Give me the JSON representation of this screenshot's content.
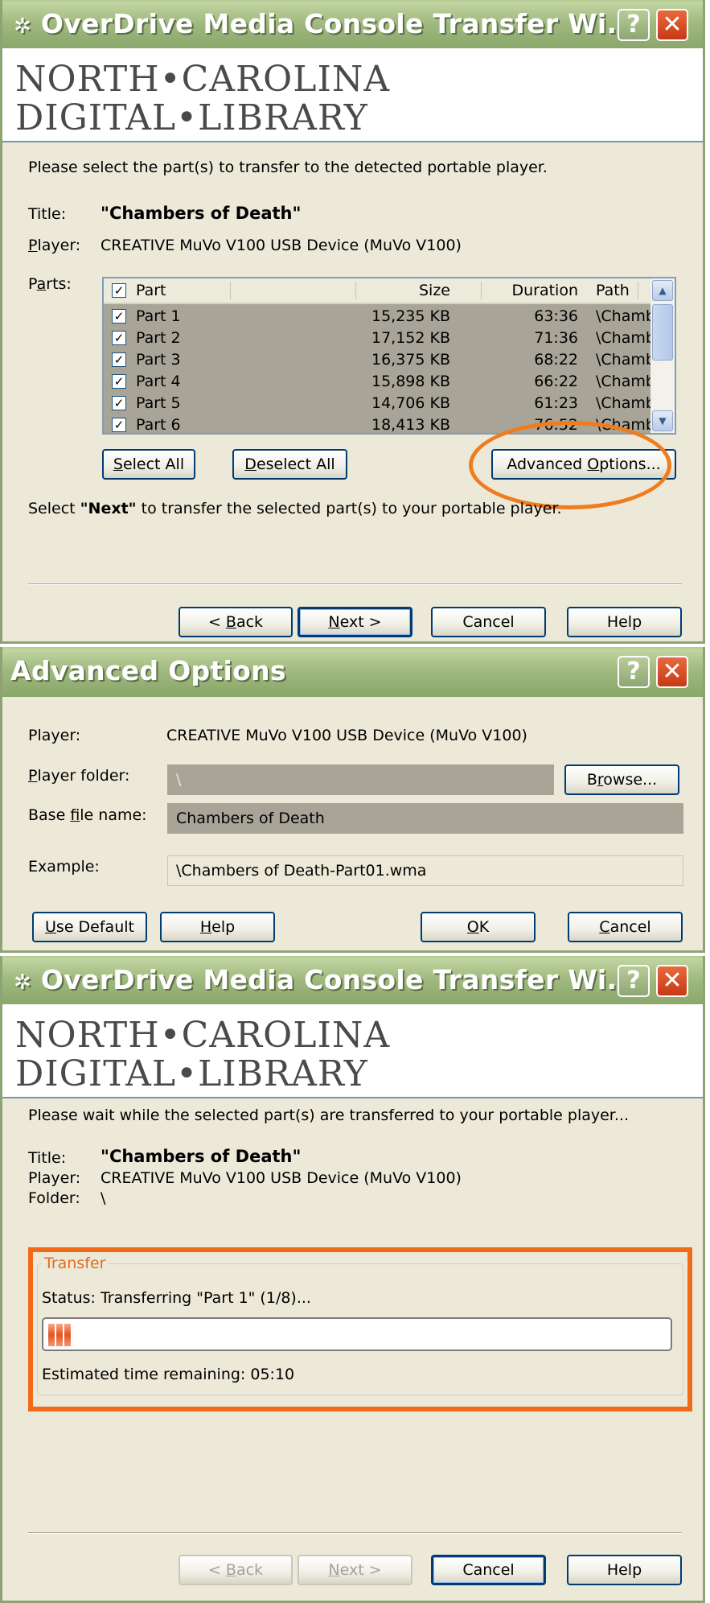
{
  "wizard1": {
    "title": "OverDrive Media Console Transfer Wi...",
    "logo_line1": "NORTH•CAROLINA",
    "logo_line2": "DIGITAL•LIBRARY",
    "instruction": "Please select the part(s) to transfer to the detected portable player.",
    "title_label": "Title:",
    "title_value": "\"Chambers of Death\"",
    "player_label": "Player:",
    "player_value": "CREATIVE MuVo V100 USB Device (MuVo V100)",
    "parts_label": "Parts:",
    "columns": {
      "part": "Part",
      "size": "Size",
      "duration": "Duration",
      "path": "Path"
    },
    "parts": [
      {
        "part": "Part 1",
        "size": "15,235 KB",
        "duration": "63:36",
        "path": "\\Chambers of D...",
        "checked": true
      },
      {
        "part": "Part 2",
        "size": "17,152 KB",
        "duration": "71:36",
        "path": "\\Chambers of D...",
        "checked": true
      },
      {
        "part": "Part 3",
        "size": "16,375 KB",
        "duration": "68:22",
        "path": "\\Chambers of D...",
        "checked": true
      },
      {
        "part": "Part 4",
        "size": "15,898 KB",
        "duration": "66:22",
        "path": "\\Chambers of D...",
        "checked": true
      },
      {
        "part": "Part 5",
        "size": "14,706 KB",
        "duration": "61:23",
        "path": "\\Chambers of D...",
        "checked": true
      },
      {
        "part": "Part 6",
        "size": "18,413 KB",
        "duration": "76:52",
        "path": "\\Chambers of D...",
        "checked": true
      }
    ],
    "select_all": "Select All",
    "deselect_all": "Deselect All",
    "advanced_options": "Advanced Options...",
    "next_hint_pre": "Select ",
    "next_hint_bold": "\"Next\"",
    "next_hint_post": " to transfer the selected part(s) to your portable player.",
    "back": "< Back",
    "next": "Next >",
    "cancel": "Cancel",
    "help": "Help"
  },
  "advanced": {
    "title": "Advanced Options",
    "player_label": "Player:",
    "player_value": "CREATIVE MuVo V100 USB Device (MuVo V100)",
    "folder_label": "Player folder:",
    "folder_value": "\\",
    "browse": "Browse...",
    "basename_label": "Base file name:",
    "basename_value": "Chambers of Death",
    "example_label": "Example:",
    "example_value": "\\Chambers of Death-Part01.wma",
    "use_default": "Use Default",
    "help": "Help",
    "ok": "OK",
    "cancel": "Cancel"
  },
  "wizard2": {
    "title": "OverDrive Media Console Transfer Wi...",
    "logo_line1": "NORTH•CAROLINA",
    "logo_line2": "DIGITAL•LIBRARY",
    "instruction": "Please wait while the selected part(s) are transferred to your portable player...",
    "title_label": "Title:",
    "title_value": "\"Chambers of Death\"",
    "player_label": "Player:",
    "player_value": "CREATIVE MuVo V100 USB Device (MuVo V100)",
    "folder_label": "Folder:",
    "folder_value": "\\",
    "group_title": "Transfer",
    "status": "Status: Transferring \"Part 1\" (1/8)...",
    "progress_blocks": 3,
    "eta": "Estimated time remaining: 05:10",
    "back": "< Back",
    "next": "Next >",
    "cancel": "Cancel",
    "help": "Help"
  },
  "colors": {
    "highlight": "#f07c1e",
    "titlebar": "#9fb97e"
  }
}
